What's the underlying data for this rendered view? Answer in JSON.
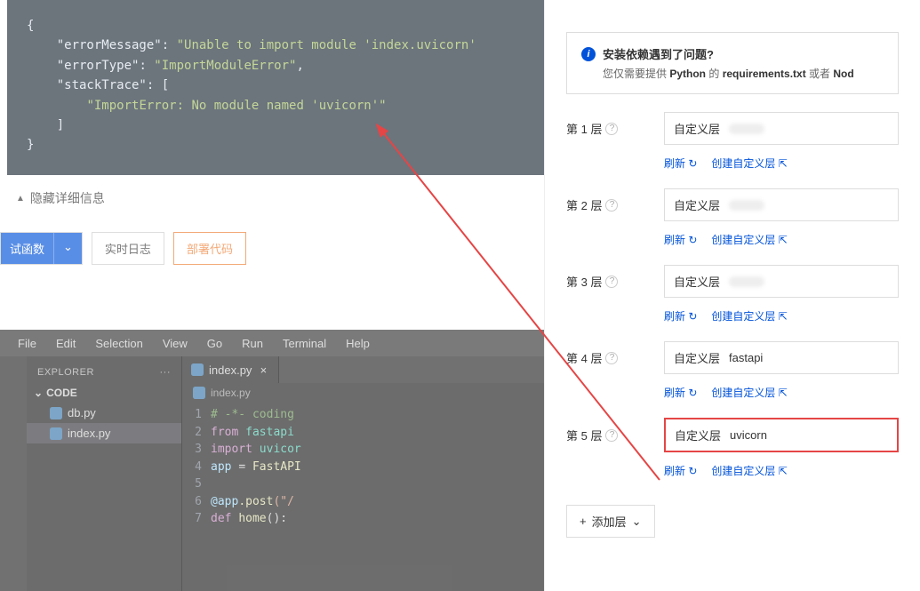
{
  "error": {
    "open_brace": "{",
    "errorMessage_key": "\"errorMessage\"",
    "errorMessage_val": "\"Unable to import module 'index.uvicorn'",
    "errorType_key": "\"errorType\"",
    "errorType_val": "\"ImportModuleError\"",
    "stackTrace_key": "\"stackTrace\"",
    "stackTrace_val": "\"ImportError: No module named 'uvicorn'\"",
    "close_brace": "}"
  },
  "collapse_label": "隐藏详细信息",
  "buttons": {
    "test": "试函数",
    "realtime": "实时日志",
    "deploy": "部署代码"
  },
  "menubar": [
    "File",
    "Edit",
    "Selection",
    "View",
    "Go",
    "Run",
    "Terminal",
    "Help"
  ],
  "explorer": {
    "label": "EXPLORER",
    "code_label": "CODE",
    "files": [
      "db.py",
      "index.py"
    ]
  },
  "tab": {
    "name": "index.py",
    "breadcrumb": "index.py"
  },
  "code": {
    "l1": "# -*- coding",
    "l2a": "from",
    "l2b": "fastapi",
    "l3a": "import",
    "l3b": "uvicor",
    "l4a": "app",
    "l4b": "=",
    "l4c": "FastAPI",
    "l6a": "@app",
    "l6b": ".post",
    "l6c": "(\"/",
    "l7a": "def",
    "l7b": "home",
    "l7c": "():"
  },
  "info": {
    "title": "安装依赖遇到了问题?",
    "sub_pre": "您仅需要提供 ",
    "sub_b1": "Python",
    "sub_mid": " 的 ",
    "sub_b2": "requirements.txt",
    "sub_post": " 或者 ",
    "sub_b3": "Nod"
  },
  "layers": {
    "prefix": "第",
    "suffix": "层",
    "custom": "自定义层",
    "refresh": "刷新",
    "create": "创建自定义层",
    "items": [
      {
        "n": " 1 ",
        "val": ""
      },
      {
        "n": " 2 ",
        "val": ""
      },
      {
        "n": " 3 ",
        "val": ""
      },
      {
        "n": " 4 ",
        "val": "fastapi"
      },
      {
        "n": " 5 ",
        "val": "uvicorn"
      }
    ]
  },
  "add_layer": "添加层"
}
